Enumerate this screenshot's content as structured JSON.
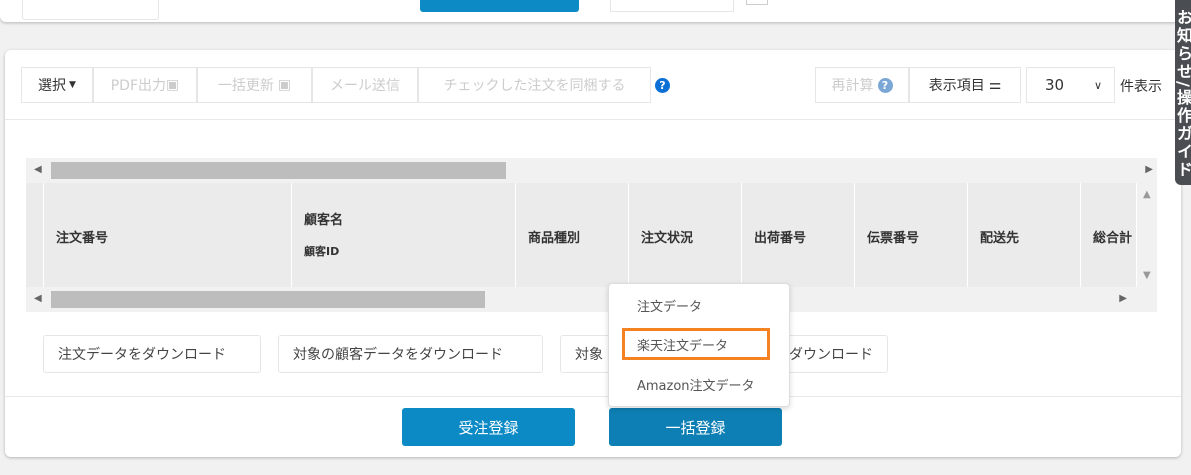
{
  "toolbar": {
    "select": "選択",
    "pdf": "PDF出力",
    "bulk_update": "一括更新",
    "mail": "メール送信",
    "bundle": "チェックした注文を同梱する",
    "help": "?",
    "recalc": "再計算",
    "columns": "表示項目",
    "per_page": "30",
    "per_page_suffix": "件表示"
  },
  "table": {
    "headers": [
      "注文番号",
      "顧客名",
      "商品種別",
      "注文状況",
      "出荷番号",
      "伝票番号",
      "配送先",
      "総合計"
    ],
    "sub_header": "顧客ID"
  },
  "downloads": {
    "order": "注文データをダウンロード",
    "customer": "対象の顧客データをダウンロード",
    "target_prefix": "対象",
    "target_suffix": "ダウンロード"
  },
  "buttons": {
    "register": "受注登録",
    "bulk_register": "一括登録"
  },
  "dropdown": {
    "items": [
      "注文データ",
      "楽天注文データ",
      "Amazon注文データ"
    ],
    "highlight_color": "#f58220"
  },
  "side_tab": "お知らせ/操作ガイド",
  "colors": {
    "primary": "#0b8ac6",
    "primary_dark": "#0e7fb4"
  }
}
